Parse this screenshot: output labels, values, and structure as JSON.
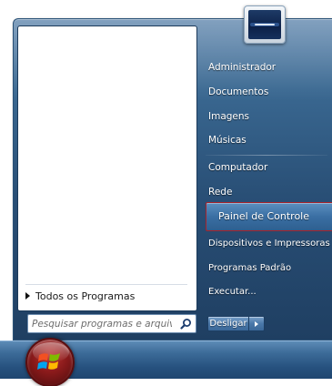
{
  "user": {
    "picture_icon": "user-account-picture"
  },
  "left_pane": {
    "all_programs_label": "Todos os Programas",
    "search_placeholder": "Pesquisar programas e arquivos"
  },
  "right_column": {
    "items": [
      "Administrador",
      "Documentos",
      "Imagens",
      "Músicas",
      "Computador",
      "Rede",
      "Painel de Controle",
      "Dispositivos e Impressoras",
      "Programas Padrão",
      "Executar..."
    ],
    "highlighted_index": 6
  },
  "shutdown": {
    "label": "Desligar",
    "options_icon": "chevron-right-icon"
  },
  "start_button": {
    "icon": "windows-logo-icon"
  },
  "colors": {
    "highlight_border": "#a8232a",
    "menu_glass": "#294f76"
  }
}
